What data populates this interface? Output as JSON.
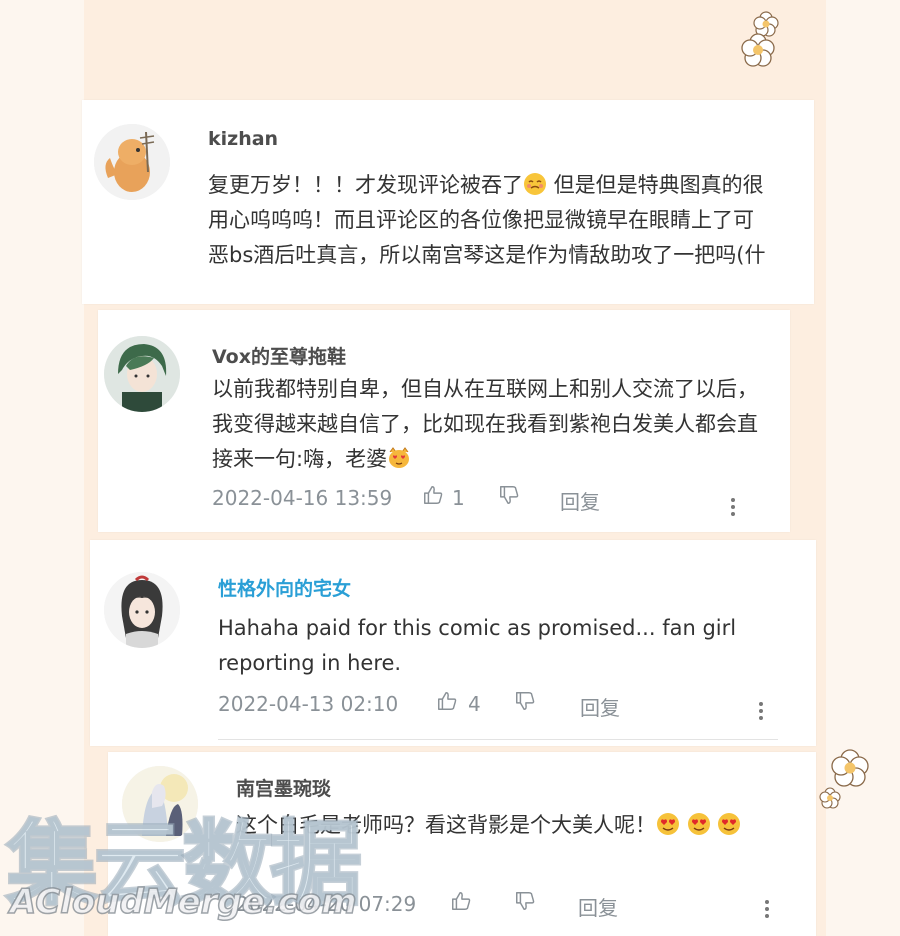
{
  "comments": [
    {
      "username": "kizhan",
      "text": "复更万岁！！！才发现评论被吞了",
      "text_after_emoji": " 但是但是特典图真的很用心呜呜呜！而且评论区的各位像把显微镜早在眼睛上了可恶bs酒后吐真言，所以南宫琴这是作为情敌助攻了一把吗(什",
      "emoji": "shy-face-emoji"
    },
    {
      "username": "Vox的至尊拖鞋",
      "text": "以前我都特别自卑，但自从在互联网上和别人交流了以后，我变得越来越自信了，比如现在我看到紫袍白发美人都会直接来一句:嗨，老婆",
      "emoji": "heart-eyes-cat-emoji",
      "time": "2022-04-16 13:59",
      "likes": "1",
      "reply_label": "回复"
    },
    {
      "username": "性格外向的宅女",
      "text": "Hahaha paid for this comic as promised... fan girl reporting in here.",
      "time": "2022-04-13 02:10",
      "likes": "4",
      "reply_label": "回复"
    },
    {
      "username": "南宫墨琬琰",
      "text": "这个白毛是老师吗？看这背影是个大美人呢！",
      "emoji": "heart-eyes-emoji",
      "time": "2022-04-20 07:29",
      "reply_label": "回复"
    }
  ],
  "watermark": {
    "chinese": "集云数据",
    "english": "ACloudMerge.com"
  },
  "colors": {
    "background": "#fdeee0",
    "card": "#ffffff",
    "username_highlight": "#2a9fd6",
    "meta_text": "#8a9197"
  }
}
